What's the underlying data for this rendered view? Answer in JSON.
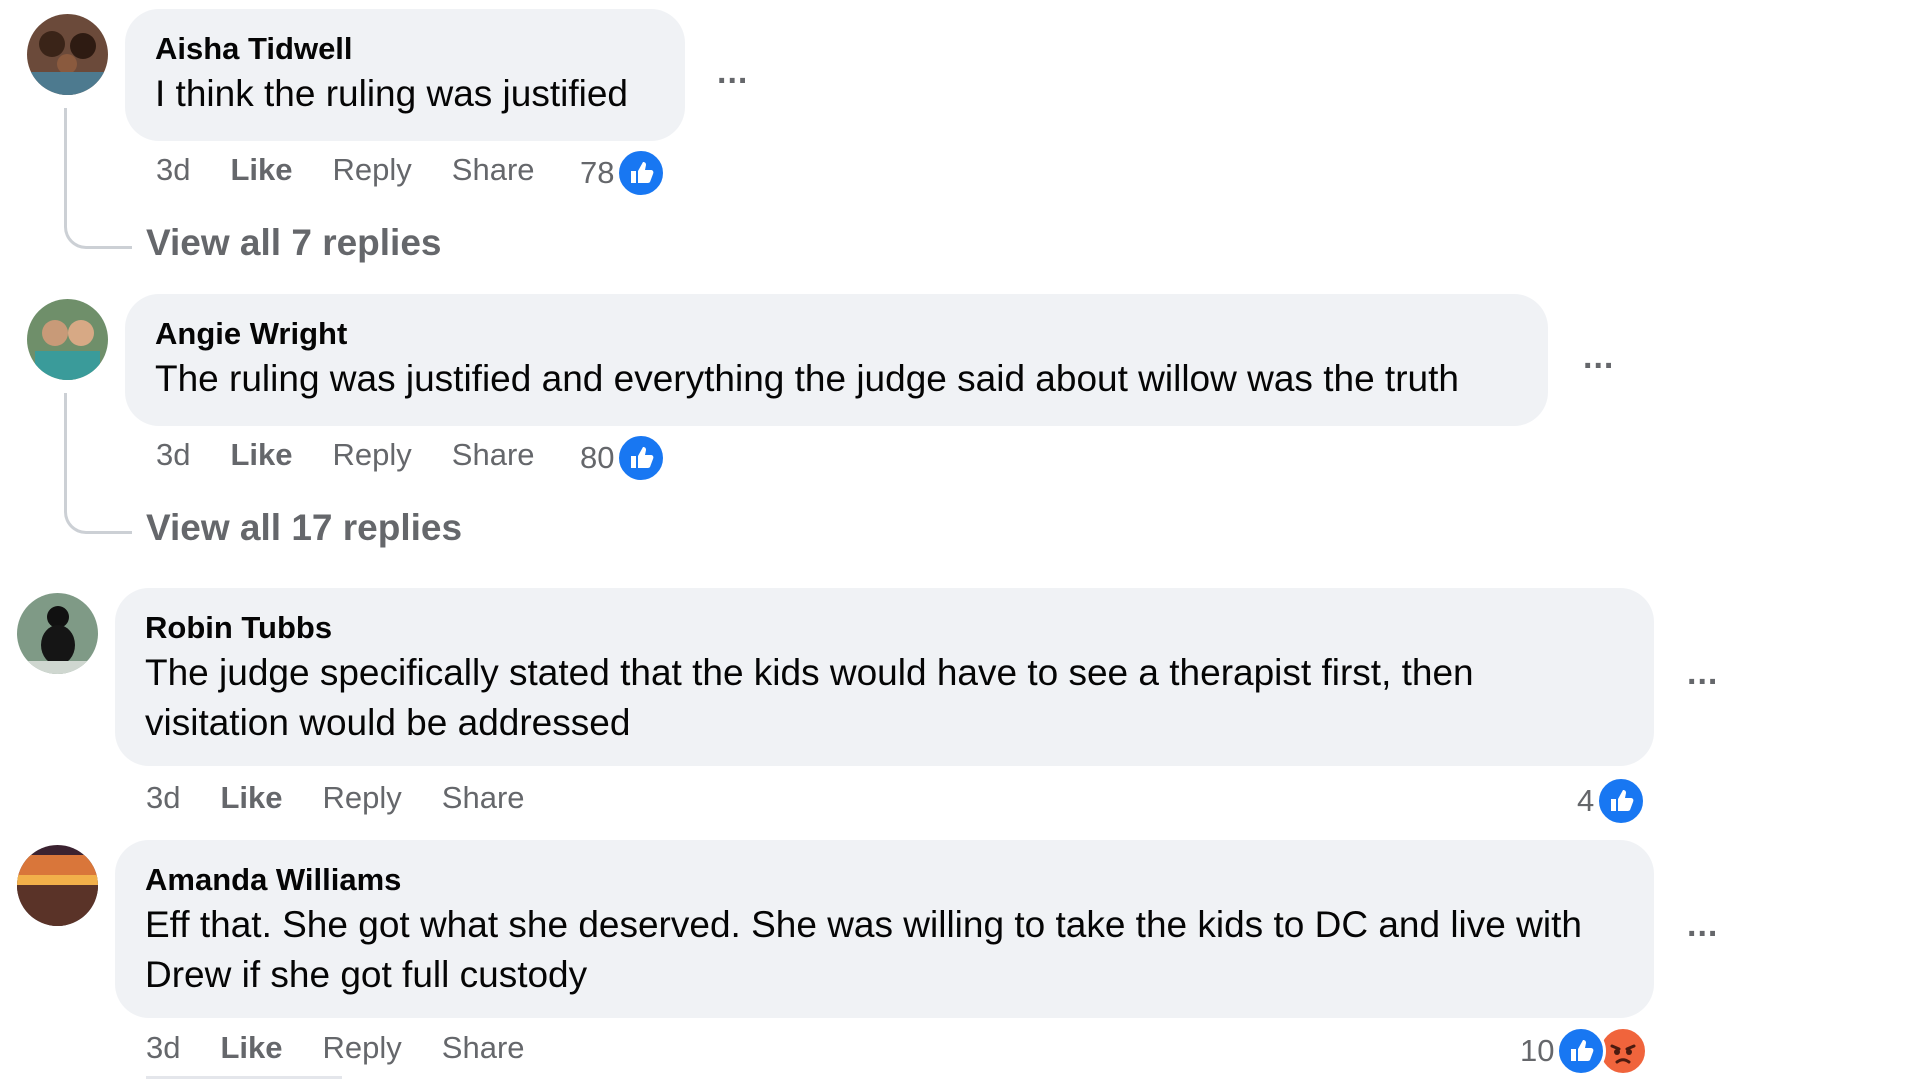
{
  "comments": [
    {
      "author": "Aisha Tidwell",
      "text": "I think the ruling was justified",
      "time": "3d",
      "like_label": "Like",
      "reply_label": "Reply",
      "share_label": "Share",
      "reaction_count": "78",
      "reactions": [
        "like"
      ],
      "view_replies": "View all 7 replies",
      "more_label": "..."
    },
    {
      "author": "Angie Wright",
      "text": "The ruling was justified and everything the judge said about willow was the truth",
      "time": "3d",
      "like_label": "Like",
      "reply_label": "Reply",
      "share_label": "Share",
      "reaction_count": "80",
      "reactions": [
        "like"
      ],
      "view_replies": "View all 17 replies",
      "more_label": "..."
    },
    {
      "author": "Robin Tubbs",
      "text": "The judge specifically stated that the kids would have to see a therapist first, then visitation would be addressed",
      "time": "3d",
      "like_label": "Like",
      "reply_label": "Reply",
      "share_label": "Share",
      "reaction_count": "4",
      "reactions": [
        "like"
      ],
      "more_label": "..."
    },
    {
      "author": "Amanda Williams",
      "text": "Eff that. She got what she deserved. She was willing to take the kids to DC and live with Drew if she got full custody",
      "time": "3d",
      "like_label": "Like",
      "reply_label": "Reply",
      "share_label": "Share",
      "reaction_count": "10",
      "reactions": [
        "like",
        "angry"
      ],
      "more_label": "..."
    }
  ],
  "colors": {
    "like_blue": "#1877f2",
    "angry_orange": "#f0643c",
    "bubble_bg": "#f0f2f5",
    "secondary_text": "#65676b"
  }
}
